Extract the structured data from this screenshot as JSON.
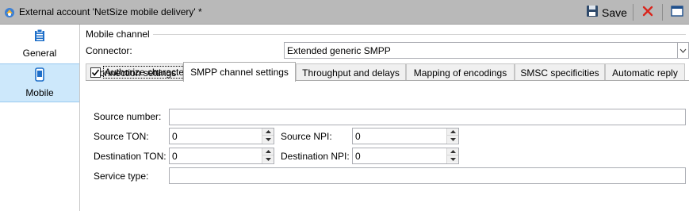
{
  "titlebar": {
    "title": "External account 'NetSize mobile delivery' *",
    "save_label": "Save",
    "icons": [
      "app-icon",
      "save-icon",
      "cancel-icon",
      "window-icon"
    ]
  },
  "sidebar": {
    "items": [
      {
        "label": "General",
        "icon": "general-icon",
        "selected": false
      },
      {
        "label": "Mobile",
        "icon": "mobile-icon",
        "selected": true
      }
    ]
  },
  "main": {
    "group_title": "Mobile channel",
    "connector_label": "Connector:",
    "connector_value": "Extended generic SMPP",
    "tabs": [
      {
        "label": "Connection settings"
      },
      {
        "label": "SMPP channel settings"
      },
      {
        "label": "Throughput and delays"
      },
      {
        "label": "Mapping of encodings"
      },
      {
        "label": "SMSC specificities"
      },
      {
        "label": "Automatic reply"
      }
    ],
    "active_tab": "SMPP channel settings",
    "form": {
      "transliteration_label": "Authorize character transliteration",
      "transliteration_checked": true,
      "source_number_label": "Source number:",
      "source_number_value": "",
      "source_ton_label": "Source TON:",
      "source_ton_value": "0",
      "source_npi_label": "Source NPI:",
      "source_npi_value": "0",
      "dest_ton_label": "Destination TON:",
      "dest_ton_value": "0",
      "dest_npi_label": "Destination NPI:",
      "dest_npi_value": "0",
      "service_type_label": "Service type:",
      "service_type_value": ""
    }
  },
  "colors": {
    "titlebar_bg": "#b9b9b9",
    "selected_nav_bg": "#cde8fb",
    "accent_blue": "#1e6fc9",
    "cancel_red": "#d9251c"
  }
}
